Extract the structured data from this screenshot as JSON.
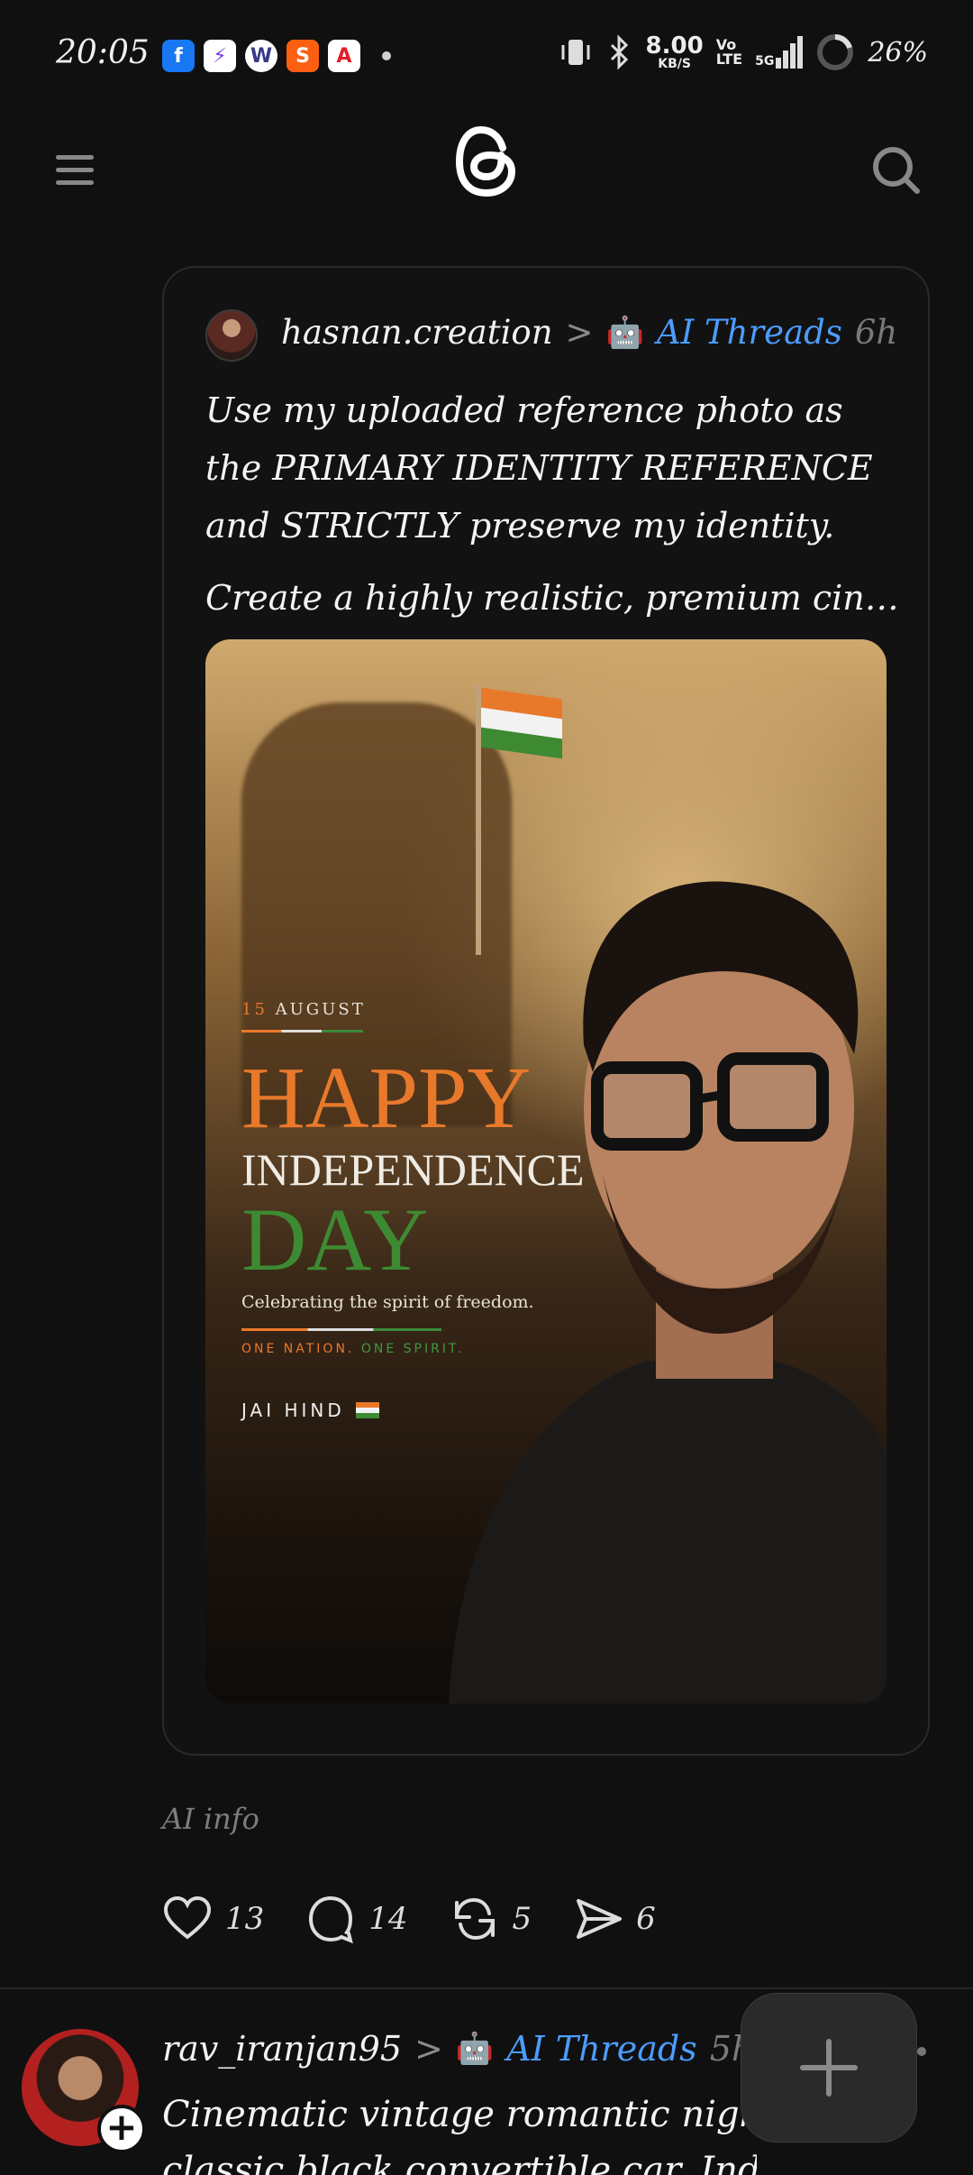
{
  "status_bar": {
    "time": "20:05",
    "apps": [
      {
        "name": "facebook-icon",
        "glyph": "f",
        "color": "#1877f2"
      },
      {
        "name": "spark-icon",
        "glyph": "⚡",
        "color": "#ffffff"
      },
      {
        "name": "wallet-icon",
        "glyph": "W",
        "color": "#ffffff"
      },
      {
        "name": "swiggy-icon",
        "glyph": "S",
        "color": "#fc5f12"
      },
      {
        "name": "adobe-icon",
        "glyph": "A",
        "color": "#ffffff"
      }
    ],
    "speed_value": "8.00",
    "speed_unit": "KB/S",
    "lte_top": "Vo",
    "lte_bottom": "LTE",
    "network": "5G",
    "battery": "26%"
  },
  "post": {
    "username": "hasnan.creation",
    "separator": ">",
    "robot": "🤖",
    "community": "AI Threads",
    "time": "6h",
    "text_p1": "Use my uploaded reference photo as the PRIMARY IDENTITY REFERENCE and STRICTLY preserve my identity.",
    "text_p2": "Create a highly realistic, premium cinema...",
    "poster": {
      "date_num": "15",
      "date_month": "AUGUST",
      "happy": "HAPPY",
      "independence": "INDEPENDENCE",
      "day": "DAY",
      "celebrate": "Celebrating the spirit of freedom.",
      "nation_a": "ONE NATION.",
      "nation_b": "ONE SPIRIT.",
      "jai_hind": "JAI HIND"
    },
    "ai_info": "AI info",
    "likes": "13",
    "replies": "14",
    "reposts": "5",
    "shares": "6"
  },
  "next_post": {
    "username": "rav_iranjan95",
    "separator": ">",
    "robot": "🤖",
    "community": "AI Threads",
    "time": "5h",
    "line1": "Cinematic vintage romantic night scene",
    "line2": "classic black convertible car, Indian"
  },
  "colors": {
    "accent": "#4c9cff",
    "saffron": "#e8792b",
    "green": "#3d8a32",
    "background": "#101010"
  }
}
